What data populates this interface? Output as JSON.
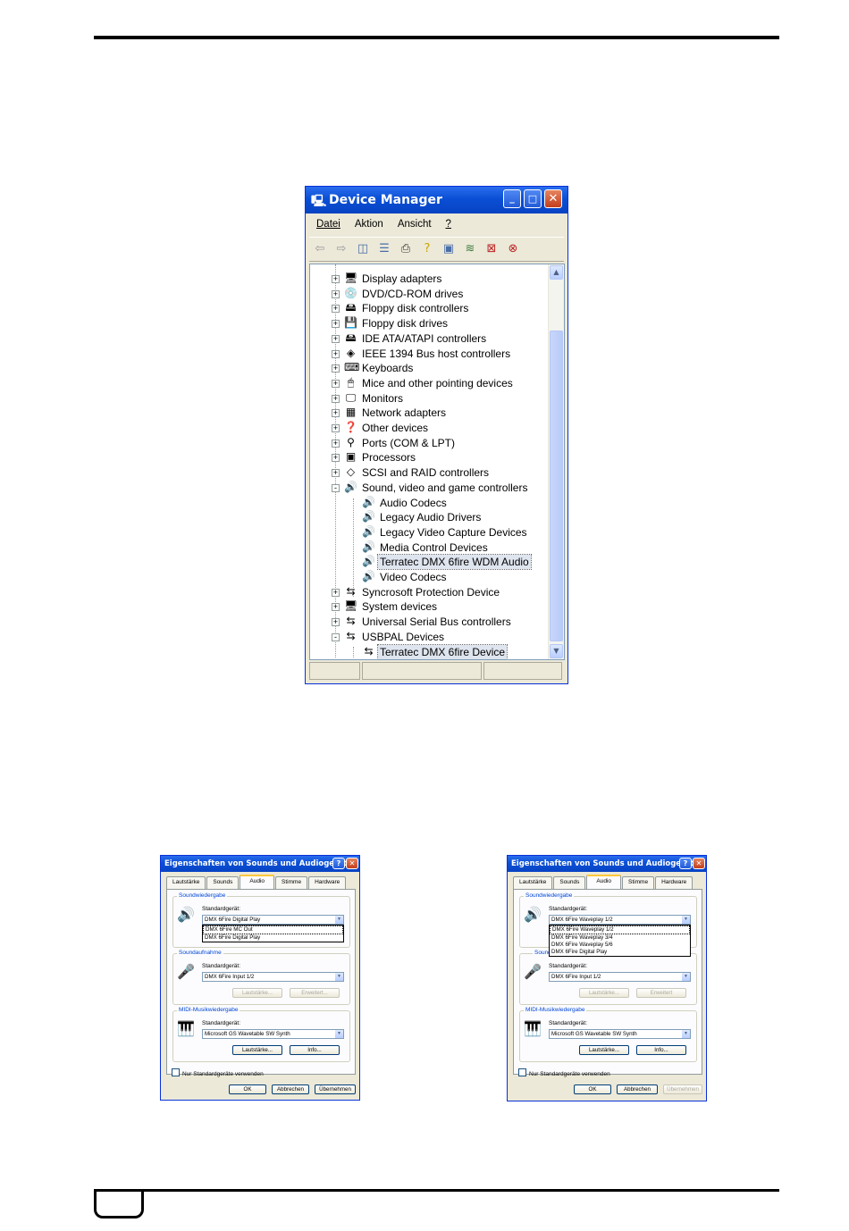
{
  "device_manager": {
    "title": "Device Manager",
    "menu": [
      "Datei",
      "Aktion",
      "Ansicht",
      "?"
    ],
    "tree": [
      {
        "label": "Display adapters",
        "icon": "🖥",
        "level": 0,
        "exp": "+"
      },
      {
        "label": "DVD/CD-ROM drives",
        "icon": "💿",
        "level": 0,
        "exp": "+"
      },
      {
        "label": "Floppy disk controllers",
        "icon": "🖴",
        "level": 0,
        "exp": "+"
      },
      {
        "label": "Floppy disk drives",
        "icon": "💾",
        "level": 0,
        "exp": "+"
      },
      {
        "label": "IDE ATA/ATAPI controllers",
        "icon": "🖴",
        "level": 0,
        "exp": "+"
      },
      {
        "label": "IEEE 1394 Bus host controllers",
        "icon": "◈",
        "level": 0,
        "exp": "+"
      },
      {
        "label": "Keyboards",
        "icon": "⌨",
        "level": 0,
        "exp": "+"
      },
      {
        "label": "Mice and other pointing devices",
        "icon": "🖱",
        "level": 0,
        "exp": "+"
      },
      {
        "label": "Monitors",
        "icon": "🖵",
        "level": 0,
        "exp": "+"
      },
      {
        "label": "Network adapters",
        "icon": "▦",
        "level": 0,
        "exp": "+"
      },
      {
        "label": "Other devices",
        "icon": "❓",
        "level": 0,
        "exp": "+"
      },
      {
        "label": "Ports (COM & LPT)",
        "icon": "⚲",
        "level": 0,
        "exp": "+"
      },
      {
        "label": "Processors",
        "icon": "▣",
        "level": 0,
        "exp": "+"
      },
      {
        "label": "SCSI and RAID controllers",
        "icon": "◇",
        "level": 0,
        "exp": "+"
      },
      {
        "label": "Sound, video and game controllers",
        "icon": "🔊",
        "level": 0,
        "exp": "−"
      },
      {
        "label": "Audio Codecs",
        "icon": "🔊",
        "level": 1
      },
      {
        "label": "Legacy Audio Drivers",
        "icon": "🔊",
        "level": 1
      },
      {
        "label": "Legacy Video Capture Devices",
        "icon": "🔊",
        "level": 1
      },
      {
        "label": "Media Control Devices",
        "icon": "🔊",
        "level": 1
      },
      {
        "label": "Terratec DMX 6fire WDM Audio",
        "icon": "🔊",
        "level": 1,
        "selected": true
      },
      {
        "label": "Video Codecs",
        "icon": "🔊",
        "level": 1
      },
      {
        "label": "Syncrosoft Protection Device",
        "icon": "⇆",
        "level": 0,
        "exp": "+"
      },
      {
        "label": "System devices",
        "icon": "🖥",
        "level": 0,
        "exp": "+"
      },
      {
        "label": "Universal Serial Bus controllers",
        "icon": "⇆",
        "level": 0,
        "exp": "+"
      },
      {
        "label": "USBPAL Devices",
        "icon": "⇆",
        "level": 0,
        "exp": "−"
      },
      {
        "label": "Terratec DMX 6fire Device",
        "icon": "⇆",
        "level": 1,
        "selected": true
      }
    ]
  },
  "dialog_left": {
    "title": "Eigenschaften von Sounds und Audiogeräte",
    "tabs": [
      "Lautstärke",
      "Sounds",
      "Audio",
      "Stimme",
      "Hardware"
    ],
    "playback": {
      "title": "Soundwiedergabe",
      "label": "Standardgerät:",
      "value": "DMX 6Fire Digital Play",
      "options": [
        "DMX 6Fire MC Out",
        "DMX 6Fire Digital Play"
      ]
    },
    "record": {
      "title": "Soundaufnahme",
      "label": "Standardgerät:",
      "value": "DMX 6Fire Input 1/2",
      "btn1": "Lautstärke...",
      "btn2": "Erweitert..."
    },
    "midi": {
      "title": "MIDI-Musikwiedergabe",
      "label": "Standardgerät:",
      "value": "Microsoft GS Wavetable SW Synth",
      "btn1": "Lautstärke...",
      "btn2": "Info..."
    },
    "checkbox": "Nur Standardgeräte verwenden",
    "ok": "OK",
    "cancel": "Abbrechen",
    "apply": "Übernehmen"
  },
  "dialog_right": {
    "title": "Eigenschaften von Sounds und Audiogeräte",
    "tabs": [
      "Lautstärke",
      "Sounds",
      "Audio",
      "Stimme",
      "Hardware"
    ],
    "playback": {
      "title": "Soundwiedergabe",
      "label": "Standardgerät:",
      "value": "DMX 6Fire Waveplay 1/2",
      "options": [
        "DMX 6Fire Waveplay 1/2",
        "DMX 6Fire Waveplay 3/4",
        "DMX 6Fire Waveplay 5/6",
        "DMX 6Fire Digital Play"
      ]
    },
    "record": {
      "title": "Sounda",
      "label": "Standardgerät:",
      "value": "DMX 6Fire Input 1/2",
      "btn1": "Lautstärke...",
      "btn2": "Erweitert"
    },
    "midi": {
      "title": "MIDI-Musikwiedergabe",
      "label": "Standardgerät:",
      "value": "Microsoft GS Wavetable SW Synth",
      "btn1": "Lautstärke...",
      "btn2": "Info..."
    },
    "checkbox": "Nur Standardgeräte verwenden",
    "ok": "OK",
    "cancel": "Abbrechen",
    "apply": "Übernehmen"
  }
}
